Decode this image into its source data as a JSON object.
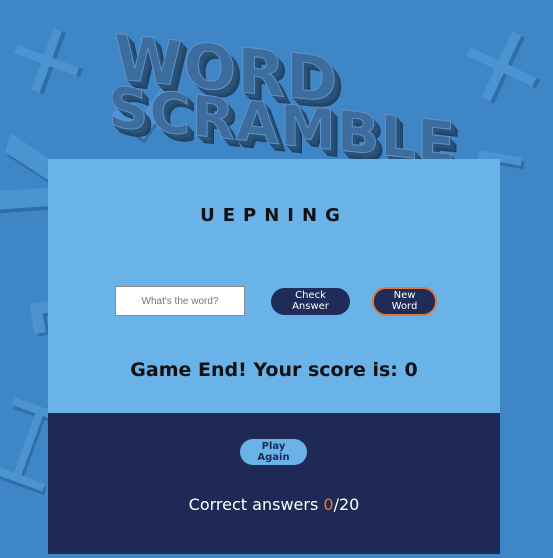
{
  "title": {
    "line1": "WORD",
    "line2": "SCRAMBLE"
  },
  "game": {
    "scrambled_word": "UEPNING",
    "input_placeholder": "What's the word?",
    "input_value": "",
    "check_button": "Check Answer",
    "new_word_button": "New Word",
    "result_message": "Game End! Your score is: 0"
  },
  "footer": {
    "play_again_button": "Play Again",
    "correct_label": "Correct answers ",
    "correct_count": "0",
    "separator": "/",
    "total": "20"
  },
  "colors": {
    "background": "#3f86c6",
    "card": "#69b3e9",
    "footer": "#1e2a55",
    "accent": "#e2773a",
    "button": "#1f2c59"
  }
}
